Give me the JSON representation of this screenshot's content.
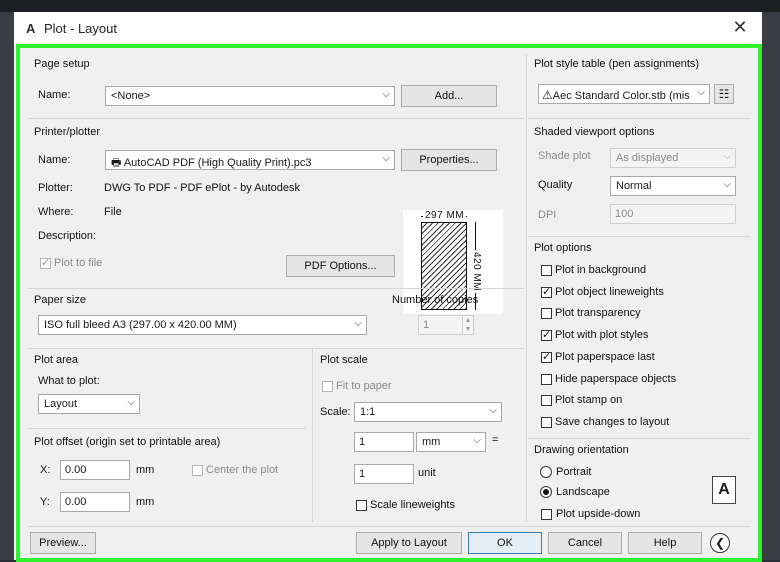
{
  "window": {
    "title": "Plot - Layout",
    "logo": "A",
    "close_glyph": "✕"
  },
  "page_setup": {
    "title": "Page setup",
    "name_label": "Name:",
    "name_value": "<None>",
    "add_button": "Add..."
  },
  "printer": {
    "title": "Printer/plotter",
    "name_label": "Name:",
    "name_value": "AutoCAD PDF (High Quality Print).pc3",
    "properties_button": "Properties...",
    "plotter_label": "Plotter:",
    "plotter_value": "DWG To PDF - PDF ePlot - by Autodesk",
    "where_label": "Where:",
    "where_value": "File",
    "description_label": "Description:",
    "plot_to_file_label": "Plot to file",
    "plot_to_file_checked": true,
    "pdf_options_button": "PDF Options...",
    "preview_width": "297 MM",
    "preview_height": "420 MM"
  },
  "paper_size": {
    "title": "Paper size",
    "value": "ISO full bleed A3 (297.00 x 420.00 MM)"
  },
  "copies": {
    "title": "Number of copies",
    "value": "1"
  },
  "plot_area": {
    "title": "Plot area",
    "what_label": "What to plot:",
    "what_value": "Layout"
  },
  "plot_offset": {
    "title": "Plot offset (origin set to printable area)",
    "x_label": "X:",
    "x_value": "0.00",
    "x_unit": "mm",
    "y_label": "Y:",
    "y_value": "0.00",
    "y_unit": "mm",
    "center_label": "Center the plot",
    "center_checked": false
  },
  "plot_scale": {
    "title": "Plot scale",
    "fit_label": "Fit to paper",
    "fit_checked": false,
    "scale_label": "Scale:",
    "scale_value": "1:1",
    "value1": "1",
    "unit1": "mm",
    "equals": "=",
    "value2": "1",
    "unit2": "unit",
    "lineweights_label": "Scale lineweights",
    "lineweights_checked": false
  },
  "style_table": {
    "title": "Plot style table (pen assignments)",
    "value": "Aec Standard Color.stb (mis"
  },
  "shaded": {
    "title": "Shaded viewport options",
    "shade_label": "Shade plot",
    "shade_value": "As displayed",
    "quality_label": "Quality",
    "quality_value": "Normal",
    "dpi_label": "DPI",
    "dpi_value": "100"
  },
  "plot_options": {
    "title": "Plot options",
    "items": [
      {
        "label": "Plot in background",
        "checked": false
      },
      {
        "label": "Plot object lineweights",
        "checked": true
      },
      {
        "label": "Plot transparency",
        "checked": false
      },
      {
        "label": "Plot with plot styles",
        "checked": true
      },
      {
        "label": "Plot paperspace last",
        "checked": true
      },
      {
        "label": "Hide paperspace objects",
        "checked": false
      },
      {
        "label": "Plot stamp on",
        "checked": false
      },
      {
        "label": "Save changes to layout",
        "checked": false
      }
    ]
  },
  "orientation": {
    "title": "Drawing orientation",
    "portrait_label": "Portrait",
    "landscape_label": "Landscape",
    "selected": "Landscape",
    "upside_label": "Plot upside-down",
    "upside_checked": false,
    "icon_letter": "A"
  },
  "footer": {
    "preview_button": "Preview...",
    "apply_button": "Apply to Layout",
    "ok_button": "OK",
    "cancel_button": "Cancel",
    "help_button": "Help",
    "collapse_glyph": "❮"
  },
  "colors": {
    "highlight_border": "#2df22d",
    "primary_button_border": "#3c7fb1"
  }
}
